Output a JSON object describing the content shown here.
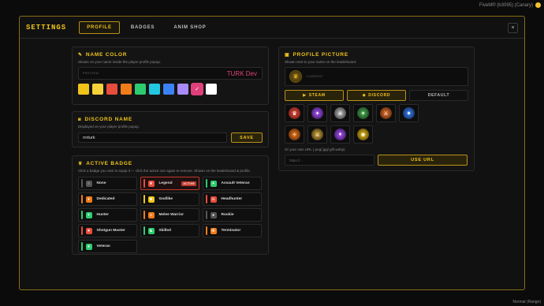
{
  "system": {
    "title": "FiveM® (b3095) (Canary)",
    "mode": "Normal (Range)"
  },
  "header": {
    "brand": "SETTINGS",
    "tabs": [
      {
        "label": "PROFILE"
      },
      {
        "label": "BADGES"
      },
      {
        "label": "ANIM SHOP"
      }
    ],
    "close_glyph": "×"
  },
  "name_color": {
    "title": "NAME COLOR",
    "subtitle": "Shown on your name inside the player profile popup.",
    "preview_label": "PREVIEW",
    "preview_value": "TURK Dev",
    "preview_color": "#e0407a",
    "swatches": [
      {
        "color": "#f0c419"
      },
      {
        "color": "#f5d23a"
      },
      {
        "color": "#e74c3c"
      },
      {
        "color": "#f07c1a"
      },
      {
        "color": "#2ecc71"
      },
      {
        "color": "#22c7e0"
      },
      {
        "color": "#3b82f6"
      },
      {
        "color": "#a78bfa"
      },
      {
        "color": "#e0407a",
        "selected": true,
        "check": "✓"
      },
      {
        "color": "#ffffff"
      }
    ]
  },
  "discord": {
    "title": "DISCORD NAME",
    "subtitle": "Displayed on your player profile popup.",
    "value": "mrturk",
    "save_label": "SAVE"
  },
  "active_badge": {
    "title": "ACTIVE BADGE",
    "subtitle": "Click a badge you own to equip it — click the active one again to remove. Shown on the leaderboard & profile.",
    "active_tag": "ACTIVE",
    "items": [
      {
        "name": "None",
        "accent": "#555555",
        "icon": "○"
      },
      {
        "name": "Legend",
        "accent": "#e74c3c",
        "icon": "♛",
        "active": true
      },
      {
        "name": "Assault Veteran",
        "accent": "#2ecc71",
        "icon": "✦"
      },
      {
        "name": "Dedicated",
        "accent": "#f07c1a",
        "icon": "♦"
      },
      {
        "name": "Godlike",
        "accent": "#f0c419",
        "icon": "♚"
      },
      {
        "name": "Headhunter",
        "accent": "#e74c3c",
        "icon": "☠"
      },
      {
        "name": "Hunter",
        "accent": "#2ecc71",
        "icon": "✶"
      },
      {
        "name": "Melee Warrior",
        "accent": "#f07c1a",
        "icon": "⚔"
      },
      {
        "name": "Rookie",
        "accent": "#555555",
        "icon": "●"
      },
      {
        "name": "Shotgun Master",
        "accent": "#e74c3c",
        "icon": "✷"
      },
      {
        "name": "Skilled",
        "accent": "#2ecc71",
        "icon": "♞"
      },
      {
        "name": "Terminator",
        "accent": "#f07c1a",
        "icon": "✠"
      },
      {
        "name": "Veteran",
        "accent": "#2ecc71",
        "icon": "★"
      }
    ]
  },
  "profile_picture": {
    "title": "PROFILE PICTURE",
    "subtitle": "Shown next to your name on the leaderboard.",
    "current_label": "CURRENT",
    "buttons": [
      {
        "label": "STEAM",
        "icon": "▶"
      },
      {
        "label": "DISCORD",
        "icon": "◆"
      },
      {
        "label": "DEFAULT"
      }
    ],
    "avatars": [
      {
        "colors": [
          "#e74c3c",
          "#5a1410"
        ],
        "icon": "♛"
      },
      {
        "colors": [
          "#a855f7",
          "#2a0f45"
        ],
        "icon": "✦"
      },
      {
        "colors": [
          "#bfbfbf",
          "#2b2b2b"
        ],
        "icon": "☠"
      },
      {
        "colors": [
          "#4caf50",
          "#11301a"
        ],
        "icon": "✶"
      },
      {
        "colors": [
          "#e8762b",
          "#3d1a08"
        ],
        "icon": "⚔"
      },
      {
        "colors": [
          "#3b82f6",
          "#0d1f44"
        ],
        "icon": "✷"
      },
      {
        "colors": [
          "#f07c1a",
          "#3d1a08"
        ],
        "icon": "✧"
      },
      {
        "colors": [
          "#d4aa40",
          "#2b2008"
        ],
        "icon": "⚔"
      },
      {
        "colors": [
          "#a855f7",
          "#2a0f45"
        ],
        "icon": "♦"
      },
      {
        "colors": [
          "#f0c419",
          "#3a2e08"
        ],
        "icon": "♚"
      }
    ],
    "url_note": "Or your own URL (.png/.jpg/.gif/.webp)",
    "url_placeholder": "https://...",
    "use_url_label": "USE URL"
  }
}
